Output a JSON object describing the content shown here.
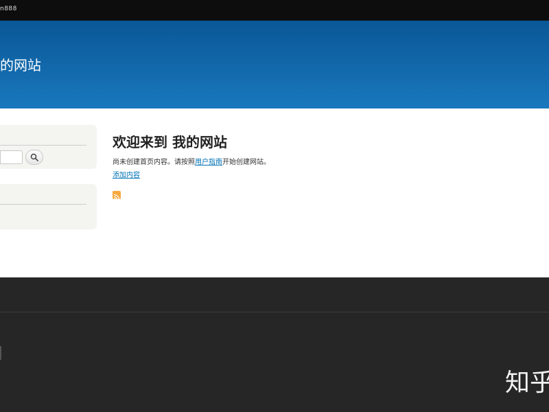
{
  "topbar": {
    "user_label": "n888"
  },
  "header": {
    "site_name": "的网站"
  },
  "sidebar": {
    "search": {
      "input_value": "",
      "button_icon": "search-icon"
    },
    "navigation": {}
  },
  "main": {
    "title": "欢迎来到 我的网站",
    "intro": {
      "before": "尚未创建首页内容。请按照",
      "link": "用户指南",
      "after": "开始创建网站。"
    },
    "add_content_link": "添加内容",
    "feed_icon": "rss-feed-icon"
  },
  "watermark": {
    "text": "知乎"
  },
  "colors": {
    "header_top": "#0a5796",
    "header_bottom": "#1978bd",
    "link": "#0071b3",
    "footer": "#262626",
    "feed": "#f8a940"
  }
}
